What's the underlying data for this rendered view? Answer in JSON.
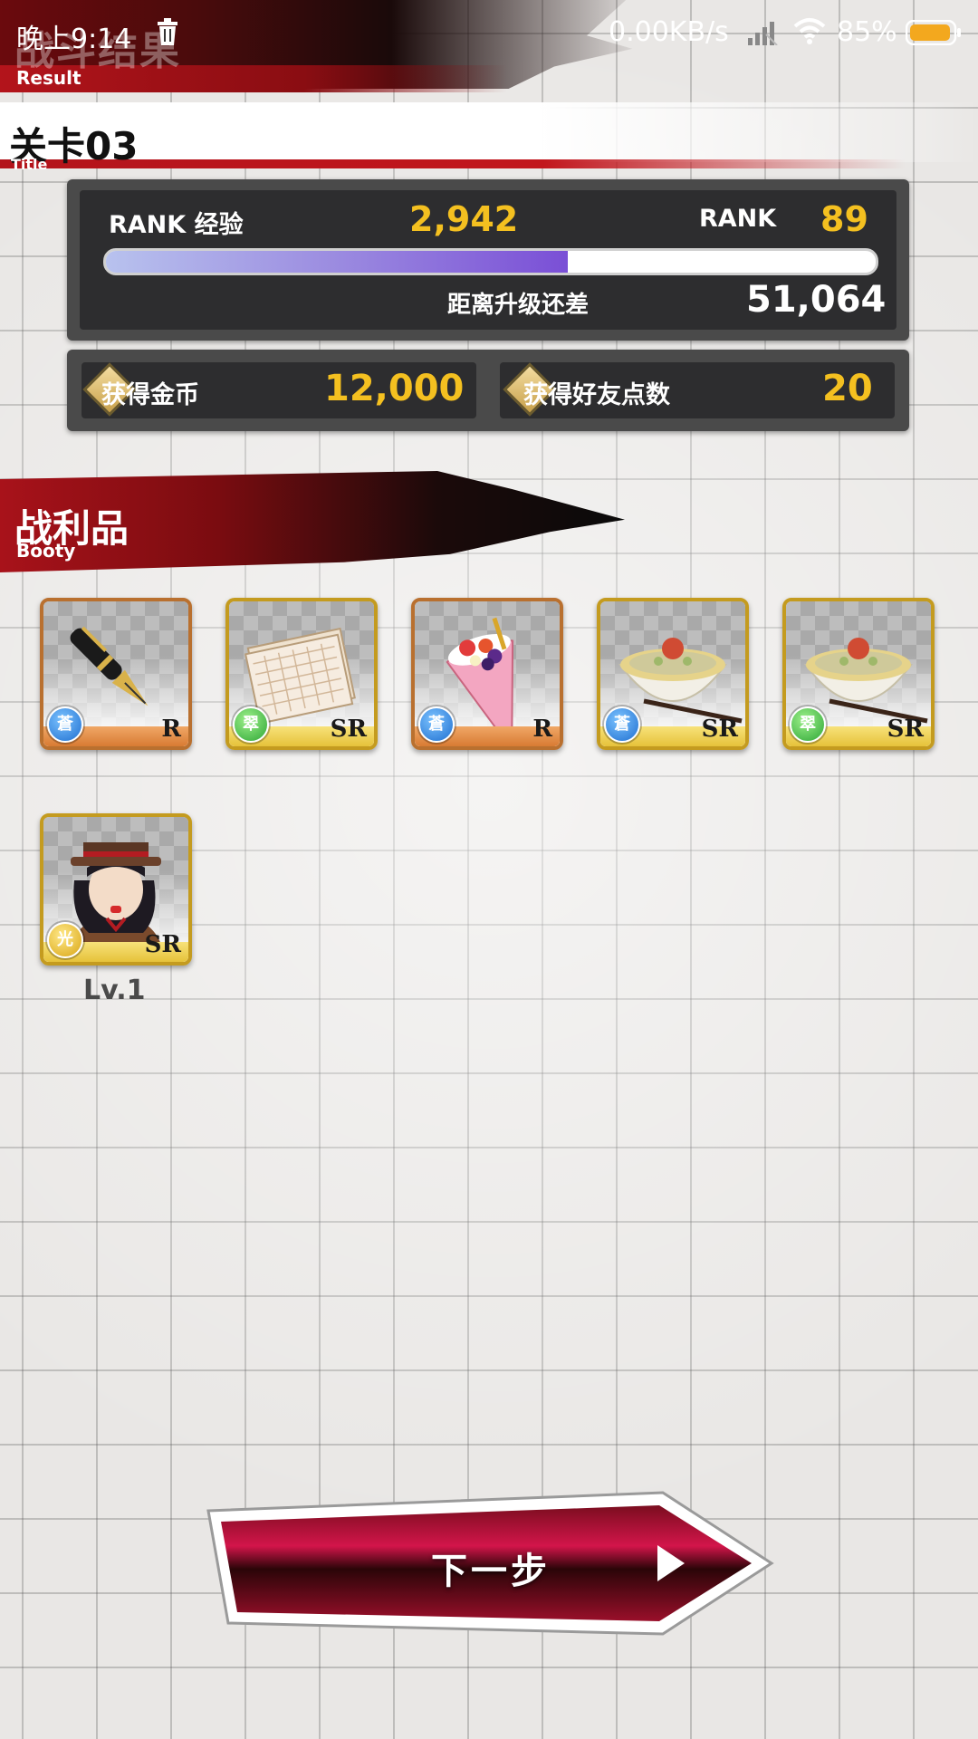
{
  "status_bar": {
    "time": "晚上9:14",
    "net_speed": "0.00KB/s",
    "battery": "85%",
    "icons": [
      "trash-icon",
      "signal-icon",
      "wifi-icon",
      "battery-icon"
    ]
  },
  "header": {
    "title": "战斗结果",
    "subtitle": "Result"
  },
  "stage": {
    "title": "关卡03",
    "subtitle": "Title"
  },
  "rank": {
    "exp_label": "RANK 经验",
    "exp_value": "2,942",
    "rank_label": "RANK",
    "rank_value": "89",
    "progress": 0.6,
    "remaining_label": "距离升级还差",
    "remaining_value": "51,064"
  },
  "rewards": {
    "coins_label": "获得金币",
    "coins_value": "12,000",
    "friend_points_label": "获得好友点数",
    "friend_points_value": "20"
  },
  "booty": {
    "title": "战利品",
    "subtitle": "Booty",
    "items": [
      {
        "name": "fountain-pen",
        "rarity": "R",
        "attribute": "blue",
        "attribute_glyph": "蒼"
      },
      {
        "name": "manuscript-paper",
        "rarity": "SR",
        "attribute": "green",
        "attribute_glyph": "翠"
      },
      {
        "name": "crepe",
        "rarity": "R",
        "attribute": "blue",
        "attribute_glyph": "蒼"
      },
      {
        "name": "rice-bowl",
        "rarity": "SR",
        "attribute": "blue",
        "attribute_glyph": "蒼"
      },
      {
        "name": "rice-bowl",
        "rarity": "SR",
        "attribute": "green",
        "attribute_glyph": "翠"
      }
    ],
    "character": {
      "rarity": "SR",
      "attribute": "yellow",
      "attribute_glyph": "光",
      "level": "Lv.1"
    }
  },
  "next_button": {
    "label": "下一步"
  },
  "colors": {
    "accent_red": "#b3141b",
    "gold_number": "#f4c020",
    "panel_dark": "#2d2d2f"
  }
}
